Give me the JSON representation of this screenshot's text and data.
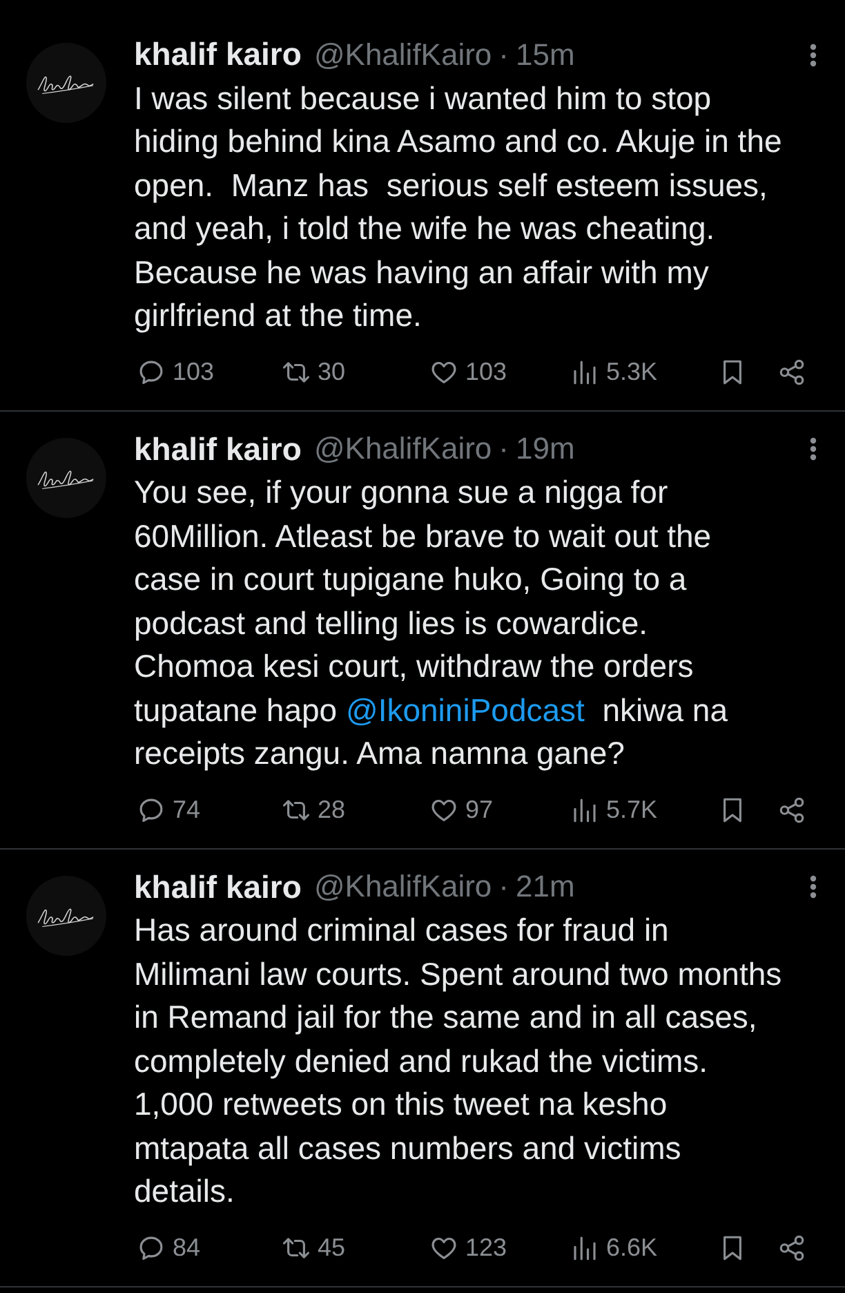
{
  "tweets": [
    {
      "author": {
        "name": "khalif kairo",
        "handle": "@KhalifKairo"
      },
      "separator": "·",
      "time": "15m",
      "body": [
        {
          "kind": "text",
          "text": "I was silent because i wanted him to stop\nhiding behind kina Asamo and co. Akuje in the\nopen.  Manz has  serious self esteem issues,\nand yeah, i told the wife he was cheating.\nBecause he was having an affair with my\ngirlfriend at the time."
        }
      ],
      "actions": [
        {
          "kind": "reply",
          "count": "103"
        },
        {
          "kind": "repost",
          "count": "30"
        },
        {
          "kind": "like",
          "count": "103"
        },
        {
          "kind": "views",
          "count": "5.3K"
        }
      ]
    },
    {
      "author": {
        "name": "khalif kairo",
        "handle": "@KhalifKairo"
      },
      "separator": "·",
      "time": "19m",
      "body": [
        {
          "kind": "text",
          "text": "You see, if your gonna sue a nigga for\n60Million. Atleast be brave to wait out the\ncase in court tupigane huko, Going to a\npodcast and telling lies is cowardice.\nChomoa kesi court, withdraw the orders\ntupatane hapo "
        },
        {
          "kind": "mention",
          "text": "@IkoniniPodcast"
        },
        {
          "kind": "text",
          "text": "  nkiwa na\nreceipts zangu. Ama namna gane?"
        }
      ],
      "actions": [
        {
          "kind": "reply",
          "count": "74"
        },
        {
          "kind": "repost",
          "count": "28"
        },
        {
          "kind": "like",
          "count": "97"
        },
        {
          "kind": "views",
          "count": "5.7K"
        }
      ]
    },
    {
      "author": {
        "name": "khalif kairo",
        "handle": "@KhalifKairo"
      },
      "separator": "·",
      "time": "21m",
      "body": [
        {
          "kind": "text",
          "text": "Has around criminal cases for fraud in\nMilimani law courts. Spent around two months\nin Remand jail for the same and in all cases,\ncompletely denied and rukad the victims.\n1,000 retweets on this tweet na kesho\nmtapata all cases numbers and victims\ndetails."
        }
      ],
      "actions": [
        {
          "kind": "reply",
          "count": "84"
        },
        {
          "kind": "repost",
          "count": "45"
        },
        {
          "kind": "like",
          "count": "123"
        },
        {
          "kind": "views",
          "count": "6.6K"
        }
      ]
    }
  ]
}
